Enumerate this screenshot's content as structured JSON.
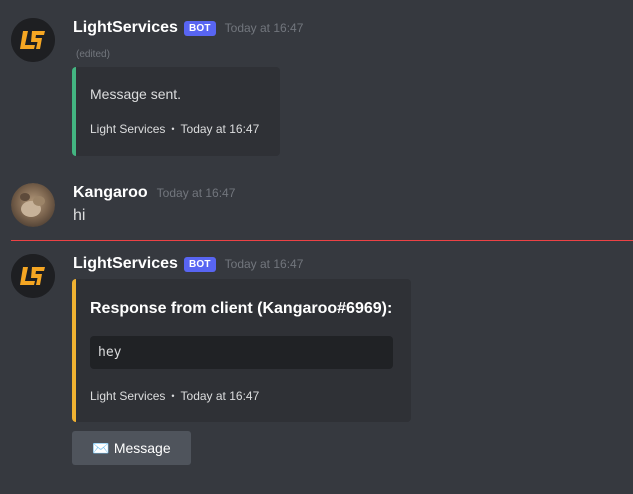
{
  "messages": [
    {
      "author": "LightServices",
      "bot_tag": "BOT",
      "timestamp": "Today at 16:47",
      "edited": "(edited)",
      "embed": {
        "description": "Message sent.",
        "footer_name": "Light Services",
        "footer_sep": "•",
        "footer_time": "Today at 16:47",
        "color": "#43b581"
      }
    },
    {
      "author": "Kangaroo",
      "timestamp": "Today at 16:47",
      "content": "hi"
    },
    {
      "author": "LightServices",
      "bot_tag": "BOT",
      "timestamp": "Today at 16:47",
      "embed": {
        "title": "Response from client (Kangaroo#6969):",
        "code": "hey",
        "footer_name": "Light Services",
        "footer_sep": "•",
        "footer_time": "Today at 16:47",
        "color": "#f0b232"
      },
      "button": {
        "emoji": "✉️",
        "label": "Message"
      }
    }
  ],
  "colors": {
    "background": "#36393f",
    "embed_bg": "#2f3136",
    "bot_tag": "#5865f2",
    "new_messages_divider": "#ed4245",
    "logo_orange": "#f5a623"
  },
  "icons": {
    "bot_avatar": "lightservices-logo-icon",
    "user_avatar": "kangaroo-photo-avatar",
    "button_emoji": "envelope-icon"
  }
}
